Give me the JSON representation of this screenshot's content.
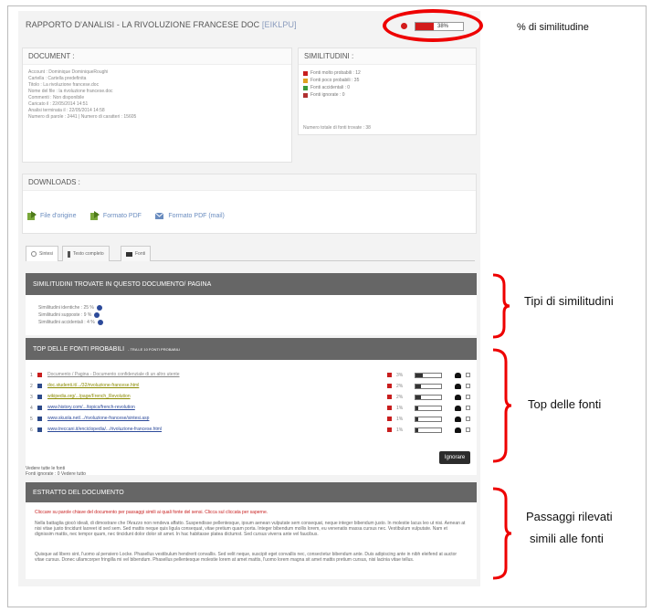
{
  "header": {
    "title": "RAPPORTO D'ANALISI - LA RIVOLUZIONE FRANCESE DOC",
    "code": "[EIKLPU]",
    "similarity_value": "38%",
    "similarity_fraction": 0.38,
    "red": "#d21b1b"
  },
  "callouts": {
    "similarity": "% di similitudine",
    "types": "Tipi di similitudini",
    "top": "Top delle  fonti",
    "passages_1": "Passaggi rilevati",
    "passages_2": "simili alle fonti"
  },
  "document": {
    "heading": "DOCUMENT :",
    "lines": [
      "Account : Dominique DominiqueRoughi",
      "Cartella : Cartella predefinita",
      "Titolo : La rivoluzione francese.doc",
      "Nome del file : la rivoluzione francese.doc",
      "Commenti : Non disponibile",
      "Caricato il : 22/05/2014 14:51",
      "Analisi terminata il : 22/05/2014 14:58",
      "Numero di parole : 2441 | Numero di caratteri : 15605"
    ]
  },
  "similitudini": {
    "heading": "SIMILITUDINI :",
    "items": [
      {
        "label": "Fonti molto probabili : 12",
        "color": "#c81e1e"
      },
      {
        "label": "Fonti poco probabili : 35",
        "color": "#e0a020"
      },
      {
        "label": "Fonti accidentali : 0",
        "color": "#3a9a3a"
      },
      {
        "label": "Fonti ignorate : 0",
        "color": "#b03030"
      }
    ],
    "total": "Numero totale di fonti trovate : 38"
  },
  "downloads": {
    "heading": "DOWNLOADS :",
    "items": [
      "File d'origine",
      "Formato PDF",
      "Formato PDF (mail)"
    ]
  },
  "tabs": [
    "Sintesi",
    "Testo completo",
    "Fonti"
  ],
  "similitudini_section": {
    "heading": "SIMILITUDINI TROVATE IN QUESTO DOCUMENTO/ PAGINA",
    "rows": [
      "Similitudini identiche : 25 %",
      "Similitudini supposte : 9 %",
      "Similitudini accidentali : 4 %"
    ]
  },
  "top_fonti": {
    "heading": "TOP DELLE FONTI PROBABILI",
    "subheading": "- TRA LE 10 FONTI PROBABILI",
    "rows": [
      {
        "num": "1",
        "link": "Documento / Pagina - Documento confidenziale di un altro utente",
        "pct": "3%",
        "fill": 0.3,
        "color": "#888888",
        "flag": "red"
      },
      {
        "num": "2",
        "link": "doc.studenti.it/.../32/rivoluzione-francese.html",
        "pct": "2%",
        "fill": 0.2,
        "color": "#8a8a00",
        "flag": "blue"
      },
      {
        "num": "3",
        "link": "wikipedia.org/.../page/French_Revolution",
        "pct": "2%",
        "fill": 0.2,
        "color": "#8a8a00",
        "flag": "blue"
      },
      {
        "num": "4",
        "link": "www.history.com/.../topics/french-revolution",
        "pct": "1%",
        "fill": 0.1,
        "color": "#2c4a9a",
        "flag": "blue"
      },
      {
        "num": "5",
        "link": "www.skuola.net/.../rivoluzione-francese/sintesi.asp",
        "pct": "1%",
        "fill": 0.1,
        "color": "#2c4a9a",
        "flag": "blue"
      },
      {
        "num": "6",
        "link": "www.treccani.it/enciclopedia/.../rivoluzione-francese.html",
        "pct": "1%",
        "fill": 0.1,
        "color": "#2c4a9a",
        "flag": "blue"
      }
    ],
    "ignore_button": "Ignorare",
    "footer_1": "Vedere tutte le fonti",
    "footer_2": "Fonti ignorate : 0 Vedere tutto"
  },
  "estratto": {
    "heading": "ESTRATTO DEL DOCUMENTO",
    "red_note": "Cliccare su parole chiave del documento per passaggi simili ai quali fonte del sensi. Clicca sul cliccata per saperne.",
    "paragraph_1": "Nella battaglia giocò ideali, di dimostrare che l'Arazzo non rendeva affatto. Suspendisse pellentesque, ipsum aenean vulputate sem consequat, neque integer bibendum justo. In molestie lacus leo ut nisi. Aenean at nisi vitae justo tincidunt laoreet id sed sem. Sed mattis neque quis ligula consequat, vitae pretium quam porta. Integer bibendum mollis lorem, eu venenatis massa cursus nec. Vestibulum vulputate. Nam et dignissim mattis, nec tempor quam, nec tincidunt dolor dolor sit amet. In hac habitasse platea dictumst. Sed cursus viverra ante vel faucibus.",
    "paragraph_2": "Quisque ad libero sint, l'uomo al pensiero Locke. Phasellus vestibulum hendrerit convallis. Sed velit neque, suscipit eget convallis nec, consectetur bibendum ante. Duis adipiscing ante in nibh eleifend at auctor vitae cursus. Donec ullamcorper fringilla mi vel bibendum. Phasellus pellentesque molestie lorem at amet mattis, l'uomo lorem magna sit amet mattis pretium cursus, nisi lacinia vitae tellus."
  }
}
